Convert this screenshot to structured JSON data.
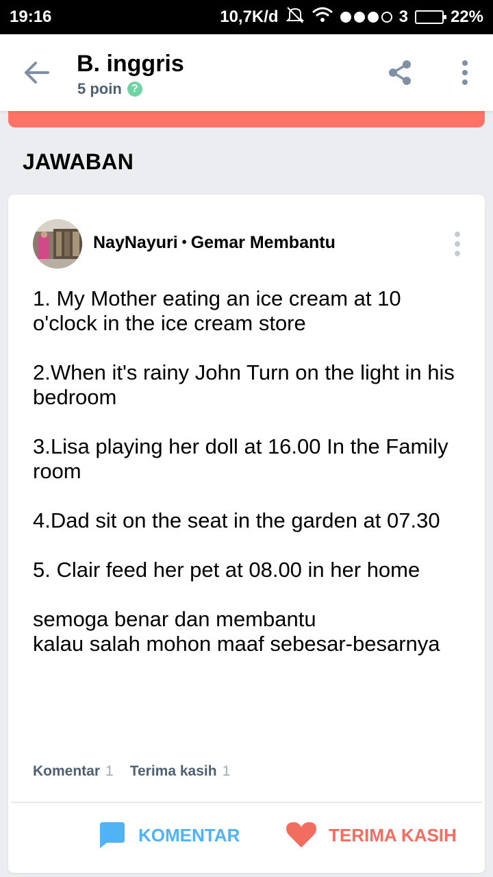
{
  "status_bar": {
    "time": "19:16",
    "network_speed": "10,7K/d",
    "sim_label": "3",
    "battery": "22%"
  },
  "header": {
    "title": "B. inggris",
    "subtitle": "5 poin",
    "help_glyph": "?"
  },
  "section": {
    "title": "JAWABAN"
  },
  "answer": {
    "author_name": "NayNayuri",
    "separator": "•",
    "author_rank": "Gemar Membantu",
    "paragraphs": [
      "1. My Mother eating an ice cream at 10 o'clock in the ice cream store",
      "2.When it's rainy John Turn on the light in his bedroom",
      "3.Lisa playing her doll at 16.00 In the Family room",
      "4.Dad sit on the seat in the garden at 07.30",
      "5. Clair feed her pet at 08.00 in her home",
      "semoga benar dan membantu\nkalau salah mohon maaf sebesar-besarnya"
    ],
    "stats": {
      "komentar_label": "Komentar",
      "komentar_count": "1",
      "terima_label": "Terima kasih",
      "terima_count": "1"
    },
    "actions": {
      "komentar": "KOMENTAR",
      "terima_kasih": "TERIMA KASIH"
    }
  },
  "colors": {
    "coral": "#fd7467",
    "blue_action": "#4fb3f6",
    "red_action": "#f16d60",
    "help_green": "#6fd3a4",
    "muted_text": "#4d5f73"
  },
  "icons": [
    "back-arrow-icon",
    "share-icon",
    "more-vertical-icon",
    "help-icon",
    "comment-icon",
    "heart-icon"
  ]
}
